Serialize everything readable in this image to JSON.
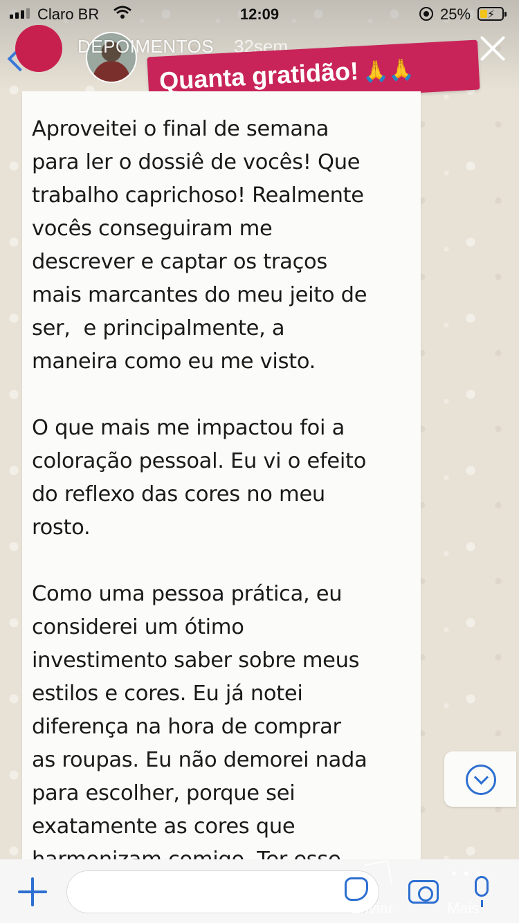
{
  "status_bar": {
    "carrier": "Claro BR",
    "time": "12:09",
    "battery_percent": "25%"
  },
  "story": {
    "name": "DEPOIMENTOS",
    "age": "32sem",
    "sticker_text": "Quanta gratidão!",
    "sticker_emoji": "🙏🙏"
  },
  "message": {
    "paragraph_1": "Aproveitei o final de semana\npara ler o dossiê de vocês! Que\ntrabalho caprichoso! Realmente\nvocês conseguiram me\ndescrever e captar os traços\nmais marcantes do meu jeito de\nser,  e principalmente, a\nmaneira como eu me visto.",
    "paragraph_2": "O que mais me impactou foi a\ncoloração pessoal. Eu vi o efeito\ndo reflexo das cores no meu\nrosto.",
    "paragraph_3": "Como uma pessoa prática, eu\nconsiderei um ótimo\ninvestimento saber sobre meus\nestilos e cores. Eu já notei\ndiferença na hora de comprar\nas roupas. Eu não demorei nada\npara escolher, porque sei\nexatamente as cores que\nharmonizam comigo. Ter esse"
  },
  "story_footer": {
    "send_label": "Enviar",
    "more_label": "Mais"
  },
  "icons": {
    "back": "chevron-left-icon",
    "close": "close-icon",
    "scroll_down": "chevron-down-circle-icon",
    "attach": "plus-icon",
    "sticker": "sticker-icon",
    "camera": "camera-icon",
    "mic": "microphone-icon"
  },
  "colors": {
    "sticker_bg": "#c8245a",
    "accent_blue": "#2d6fd1",
    "bubble_bg": "#fbfbf9"
  }
}
